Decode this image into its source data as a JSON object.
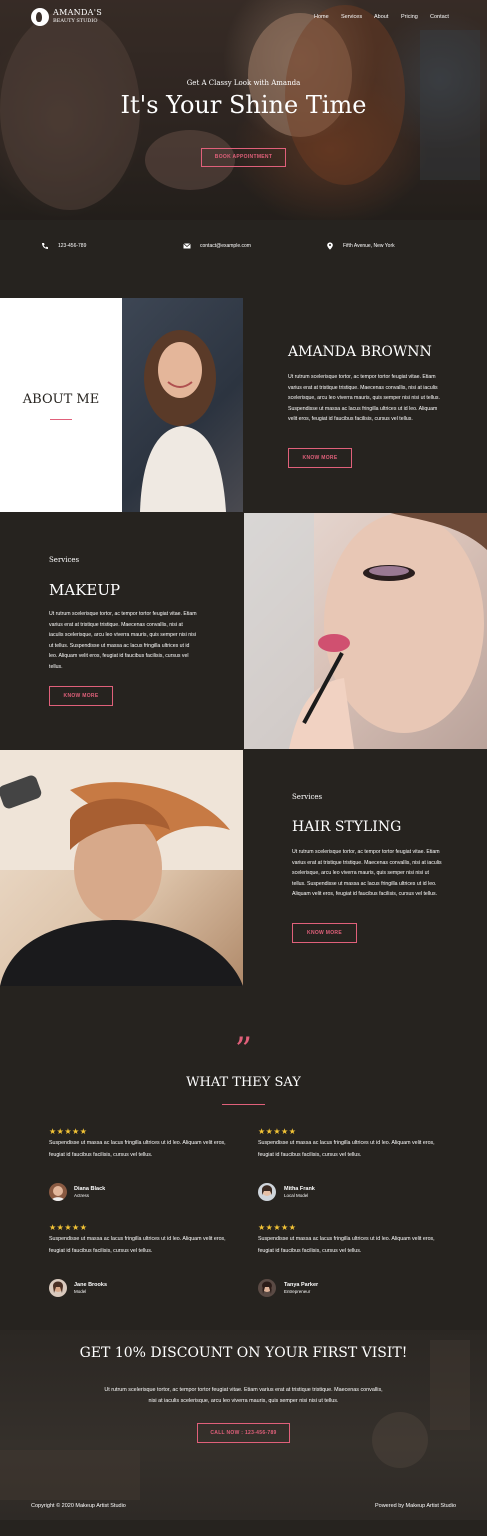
{
  "brand": {
    "name": "AMANDA'S",
    "tagline": "BEAUTY STUDIO"
  },
  "nav": {
    "items": [
      "Home",
      "Services",
      "About",
      "Pricing",
      "Contact"
    ]
  },
  "hero": {
    "subtitle": "Get A Classy Look with Amanda",
    "title": "It's Your Shine Time",
    "cta": "BOOK APPOINTMENT"
  },
  "contact": {
    "phone": "123-456-789",
    "email": "contact@example.com",
    "address": "Fifth Avenue, New York"
  },
  "about": {
    "heading": "ABOUT ME",
    "name": "AMANDA BROWNN",
    "text": "Ut rutrum scelerisque tortor, ac tempor tortor feugiat vitae. Etiam varius erat at tristique tristique. Maecenas convallis, nisi at iaculis scelerisque, arcu leo viverra mauris, quis semper nisi nisi ut tellus. Suspendisse ut massa ac lacus fringilla ultrices ut id leo. Aliquam velit eros, feugiat id faucibus facilisis, cursus vel tellus.",
    "button": "KNOW MORE"
  },
  "services": [
    {
      "label": "Services",
      "title": "MAKEUP",
      "text": "Ut rutrum scelerisque tortor, ac tempor tortor feugiat vitae. Etiam varius erat at tristique tristique. Maecenas convallis, nisi at iaculis scelerisque, arcu leo viverra mauris, quis semper nisi nisi ut tellus. Suspendisse ut massa ac lacus fringilla ultrices ut id leo. Aliquam velit eros, feugiat id faucibus facilisis, cursus vel tellus.",
      "button": "KNOW MORE"
    },
    {
      "label": "Services",
      "title": "HAIR STYLING",
      "text": "Ut rutrum scelerisque tortor, ac tempor tortor feugiat vitae. Etiam varius erat at tristique tristique. Maecenas convallis, nisi at iaculis scelerisque, arcu leo viverra mauris, quis semper nisi nisi ut tellus. Suspendisse ut massa ac lacus fringilla ultrices ut id leo. Aliquam velit eros, feugiat id faucibus facilisis, cursus vel tellus.",
      "button": "KNOW MORE"
    }
  ],
  "testimonials": {
    "heading": "WHAT THEY SAY",
    "quote_mark": "”",
    "items": [
      {
        "stars": "★★★★★",
        "text": "Suspendisse ut massa ac lacus fringilla ultrices ut id leo. Aliquam velit eros, feugiat id faucibus facilisis, cursus vel tellus.",
        "name": "Diana Black",
        "role": "Actress"
      },
      {
        "stars": "★★★★★",
        "text": "Suspendisse ut massa ac lacus fringilla ultrices ut id leo. Aliquam velit eros, feugiat id faucibus facilisis, cursus vel tellus.",
        "name": "Mitha Frank",
        "role": "Local Model"
      },
      {
        "stars": "★★★★★",
        "text": "Suspendisse ut massa ac lacus fringilla ultrices ut id leo. Aliquam velit eros, feugiat id faucibus facilisis, cursus vel tellus.",
        "name": "Jane Brooks",
        "role": "Model"
      },
      {
        "stars": "★★★★★",
        "text": "Suspendisse ut massa ac lacus fringilla ultrices ut id leo. Aliquam velit eros, feugiat id faucibus facilisis, cursus vel tellus.",
        "name": "Tanya Parker",
        "role": "Entrepreneur"
      }
    ]
  },
  "discount": {
    "title": "GET 10% DISCOUNT ON YOUR FIRST VISIT!",
    "text_line1": "Ut rutrum scelerisque tortor, ac tempor tortor feugiat vitae. Etiam varius erat at tristique tristique. Maecenas convallis,",
    "text_line2": "nisi at iaculis scelerisque, arcu leo viverra mauris, quis semper nisi nisi ut tellus.",
    "button": "CALL NOW : 123-456-789"
  },
  "footer": {
    "copyright": "Copyright © 2020 Makeup Artist Studio",
    "powered": "Powered by Makeup Artist Studio"
  },
  "colors": {
    "accent": "#e0607a",
    "background": "#26231f",
    "star": "#f3c436"
  }
}
